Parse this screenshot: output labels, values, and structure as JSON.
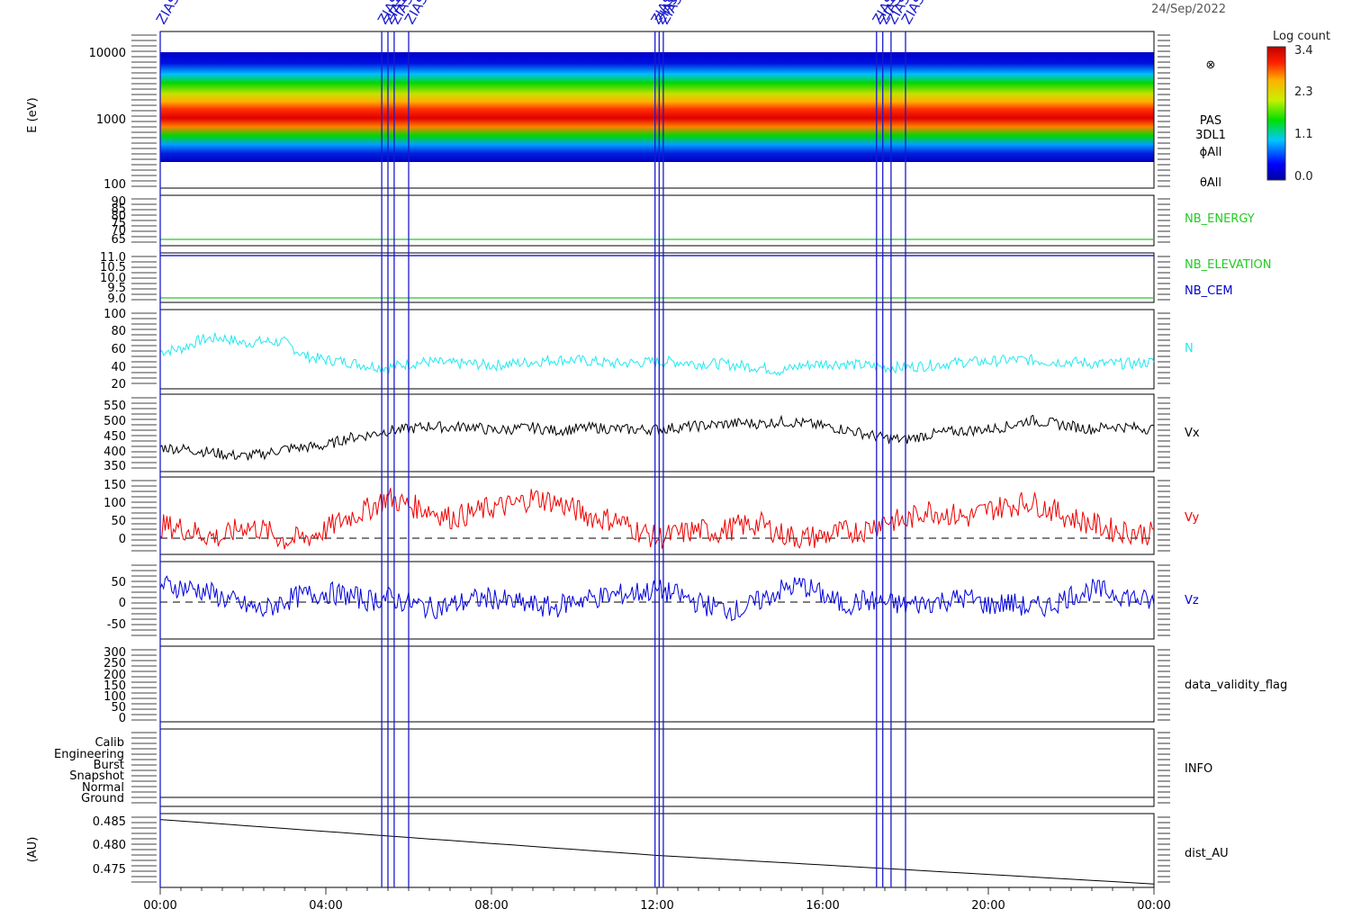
{
  "header": {
    "date": "24/Sep/2022"
  },
  "colorbar": {
    "title": "Log count",
    "ticks": [
      "3.4",
      "2.3",
      "1.1",
      "0.0"
    ]
  },
  "x_axis": {
    "ticks": [
      "00:00",
      "04:00",
      "08:00",
      "12:00",
      "16:00",
      "20:00",
      "00:00"
    ]
  },
  "event_markers": [
    {
      "hour": 0.0,
      "label": "ZIAS"
    },
    {
      "hour": 5.35,
      "label": "ZIAS"
    },
    {
      "hour": 5.5,
      "label": "ZIAS"
    },
    {
      "hour": 5.65,
      "label": "ZIAS"
    },
    {
      "hour": 6.0,
      "label": "ZIAS"
    },
    {
      "hour": 11.95,
      "label": "ZIAS"
    },
    {
      "hour": 12.05,
      "label": "ZIAS"
    },
    {
      "hour": 12.15,
      "label": "ZIAS"
    },
    {
      "hour": 17.3,
      "label": "ZIAS"
    },
    {
      "hour": 17.45,
      "label": "ZIAS"
    },
    {
      "hour": 17.65,
      "label": "ZIAS"
    },
    {
      "hour": 18.0,
      "label": "ZIAS"
    }
  ],
  "panels": {
    "spectrogram": {
      "ylabel": "E (eV)",
      "yticks": [
        "10000",
        "1000",
        "100"
      ],
      "side_labels": [
        "PAS",
        "3DL1",
        "ϕAll",
        "θAll"
      ],
      "side_symbol": "⊗",
      "colors": {
        "low": "#0000c8",
        "mid": "#00d800",
        "high": "#ff0000"
      }
    },
    "nb_energy": {
      "yticks": [
        "90",
        "85",
        "80",
        "75",
        "70",
        "65"
      ],
      "label": "NB_ENERGY",
      "color": "#22cc22"
    },
    "nb_elev": {
      "yticks": [
        "11.0",
        "10.5",
        "10.0",
        "9.5",
        "9.0"
      ],
      "labels": [
        {
          "text": "NB_ELEVATION",
          "color": "#22cc22"
        },
        {
          "text": "NB_CEM",
          "color": "#0000cc"
        }
      ]
    },
    "density": {
      "yticks": [
        "100",
        "80",
        "60",
        "40",
        "20"
      ],
      "label": "N",
      "color": "#22e8f0"
    },
    "vx": {
      "yticks": [
        "550",
        "500",
        "450",
        "400",
        "350"
      ],
      "label": "Vx",
      "color": "#000000"
    },
    "vy": {
      "yticks": [
        "150",
        "100",
        "50",
        "0"
      ],
      "label": "Vy",
      "color": "#ee0000"
    },
    "vz": {
      "yticks": [
        "50",
        "0",
        "-50"
      ],
      "label": "Vz",
      "color": "#0000dd"
    },
    "flag": {
      "yticks": [
        "300",
        "250",
        "200",
        "150",
        "100",
        "50",
        "0"
      ],
      "label": "data_validity_flag"
    },
    "info": {
      "yticks": [
        "Calib",
        "Engineering",
        "Burst",
        "Snapshot",
        "Normal",
        "Ground"
      ],
      "label": "INFO"
    },
    "dist": {
      "ylabel": "(AU)",
      "yticks": [
        "0.485",
        "0.480",
        "0.475"
      ],
      "label": "dist_AU"
    }
  },
  "chart_data": {
    "type": "line",
    "x_unit": "hour",
    "x_range": [
      0,
      24
    ],
    "series": [
      {
        "name": "N",
        "ylim": [
          15,
          100
        ],
        "x": [
          0,
          0.5,
          1,
          1.5,
          2,
          2.5,
          3,
          3.5,
          4,
          4.5,
          5,
          5.5,
          6,
          6.5,
          7,
          7.5,
          8,
          8.5,
          9,
          9.5,
          10,
          10.5,
          11,
          11.5,
          12,
          12.5,
          13,
          13.5,
          14,
          14.5,
          15,
          15.5,
          16,
          16.5,
          17,
          17.5,
          18,
          18.5,
          19,
          19.5,
          20,
          20.5,
          21,
          21.5,
          22,
          22.5,
          23,
          23.5,
          24
        ],
        "y": [
          55,
          58,
          68,
          70,
          64,
          66,
          65,
          50,
          46,
          44,
          40,
          38,
          42,
          44,
          42,
          42,
          40,
          42,
          44,
          46,
          46,
          44,
          42,
          43,
          44,
          44,
          42,
          42,
          40,
          38,
          34,
          40,
          42,
          42,
          40,
          38,
          38,
          40,
          42,
          44,
          44,
          46,
          46,
          44,
          44,
          42,
          42,
          42,
          44
        ]
      },
      {
        "name": "Vx",
        "ylim": [
          320,
          575
        ],
        "x": [
          0,
          0.5,
          1,
          1.5,
          2,
          2.5,
          3,
          3.5,
          4,
          4.5,
          5,
          5.5,
          6,
          6.5,
          7,
          7.5,
          8,
          8.5,
          9,
          9.5,
          10,
          10.5,
          11,
          11.5,
          12,
          12.5,
          13,
          13.5,
          14,
          14.5,
          15,
          15.5,
          16,
          16.5,
          17,
          17.5,
          18,
          18.5,
          19,
          19.5,
          20,
          20.5,
          21,
          21.5,
          22,
          22.5,
          23,
          23.5,
          24
        ],
        "y": [
          400,
          395,
          388,
          378,
          370,
          378,
          395,
          400,
          405,
          430,
          440,
          455,
          460,
          470,
          465,
          470,
          455,
          460,
          465,
          455,
          460,
          465,
          460,
          458,
          460,
          465,
          470,
          475,
          480,
          478,
          485,
          480,
          470,
          460,
          445,
          430,
          425,
          440,
          450,
          455,
          460,
          470,
          490,
          480,
          470,
          460,
          470,
          465,
          460
        ]
      },
      {
        "name": "Vy",
        "ylim": [
          -30,
          160
        ],
        "x": [
          0,
          0.5,
          1,
          1.5,
          2,
          2.5,
          3,
          3.5,
          4,
          4.5,
          5,
          5.5,
          6,
          6.5,
          7,
          7.5,
          8,
          8.5,
          9,
          9.5,
          10,
          10.5,
          11,
          11.5,
          12,
          12.5,
          13,
          13.5,
          14,
          14.5,
          15,
          15.5,
          16,
          16.5,
          17,
          17.5,
          18,
          18.5,
          19,
          19.5,
          20,
          20.5,
          21,
          21.5,
          22,
          22.5,
          23,
          23.5,
          24
        ],
        "y": [
          40,
          35,
          20,
          10,
          40,
          30,
          5,
          10,
          30,
          60,
          80,
          110,
          90,
          80,
          60,
          70,
          85,
          90,
          110,
          100,
          80,
          60,
          55,
          30,
          10,
          20,
          30,
          25,
          40,
          45,
          20,
          10,
          15,
          25,
          30,
          55,
          50,
          80,
          70,
          60,
          80,
          90,
          100,
          80,
          60,
          45,
          30,
          25,
          20
        ]
      },
      {
        "name": "Vz",
        "ylim": [
          -75,
          75
        ],
        "x": [
          0,
          0.5,
          1,
          1.5,
          2,
          2.5,
          3,
          3.5,
          4,
          4.5,
          5,
          5.5,
          6,
          6.5,
          7,
          7.5,
          8,
          8.5,
          9,
          9.5,
          10,
          10.5,
          11,
          11.5,
          12,
          12.5,
          13,
          13.5,
          14,
          14.5,
          15,
          15.5,
          16,
          16.5,
          17,
          17.5,
          18,
          18.5,
          19,
          19.5,
          20,
          20.5,
          21,
          21.5,
          22,
          22.5,
          23,
          23.5,
          24
        ],
        "y": [
          30,
          25,
          20,
          5,
          -10,
          -20,
          0,
          10,
          15,
          10,
          0,
          5,
          -5,
          -15,
          -10,
          0,
          5,
          -5,
          -10,
          -15,
          0,
          5,
          10,
          15,
          20,
          10,
          -5,
          -15,
          -20,
          0,
          20,
          30,
          10,
          -10,
          0,
          -5,
          -10,
          -5,
          0,
          5,
          -10,
          -5,
          -15,
          -10,
          10,
          20,
          15,
          5,
          -5
        ]
      },
      {
        "name": "dist_AU",
        "ylim": [
          0.4715,
          0.4865
        ],
        "x": [
          0,
          12,
          24
        ],
        "y": [
          0.4853,
          0.478,
          0.4722
        ]
      }
    ]
  }
}
